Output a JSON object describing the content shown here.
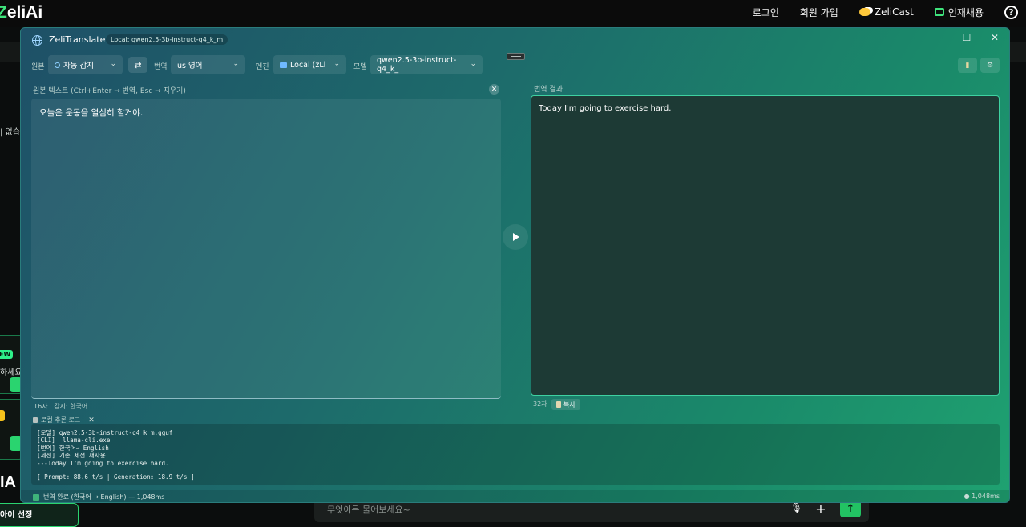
{
  "background": {
    "logo": "eliAi",
    "logo_prefix": "Z",
    "nav": {
      "login": "로그인",
      "signup": "회원 가입",
      "zelicast": "ZeliCast",
      "jobs": "인재채용",
      "help": "?"
    },
    "left_text": "| 없습",
    "new_badge": "EW",
    "left_text2": "하세요",
    "big_text": "IA",
    "bottom_card": "아이 선정",
    "chat_placeholder": "무엇이든 물어보세요~",
    "chat_plus": "+",
    "chat_send": "↑"
  },
  "window": {
    "title": "ZeliTranslate",
    "model_badge": "Local: qwen2.5-3b-instruct-q4_k_m",
    "controls": {
      "minimize": "—",
      "maximize": "☐",
      "close": "✕"
    }
  },
  "toolbar": {
    "source_label": "원본",
    "source_value": "자동 감지",
    "swap": "⇄",
    "target_label": "번역",
    "target_value": "us 영어",
    "engine_label": "엔진",
    "engine_value": "Local (zLl",
    "model_label": "모델",
    "model_value": "qwen2.5-3b-instruct-q4_k_"
  },
  "source": {
    "label": "원본 텍스트 (Ctrl+Enter → 번역, Esc → 지우기)",
    "text": "오늘은 운동을 열심히 할거야.",
    "count": "16자",
    "detected": "감지: 한국어",
    "clear": "✕"
  },
  "output": {
    "label": "번역 결과",
    "text": "Today I'm going to exercise hard.",
    "count": "32자",
    "copy": "복사"
  },
  "log": {
    "title": "로컬 추론 로그",
    "close": "✕",
    "lines": [
      "[모델] qwen2.5-3b-instruct-q4_k_m.gguf",
      "[CLI]  llama-cli.exe",
      "[번역] 한국어→ English",
      "[세션] 기존 세션 재사용",
      "---Today I'm going to exercise hard."
    ],
    "perf": "[ Prompt: 88.6 t/s | Generation: 18.9 t/s ]"
  },
  "status": {
    "left": "번역 완료 (한국어 → English) — 1,048ms",
    "right": "1,048ms"
  },
  "colors": {
    "accent": "#3ed1a1",
    "brand_green": "#3fe37c"
  }
}
